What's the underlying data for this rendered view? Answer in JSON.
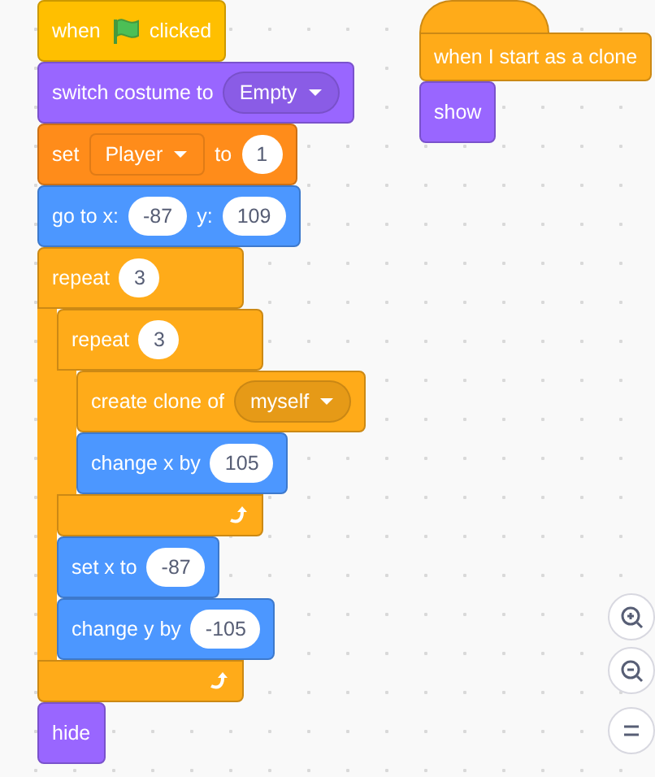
{
  "scripts": [
    {
      "blocks": [
        {
          "kind": "hat",
          "color": "#ffbf00",
          "parts": [
            {
              "kind": "label",
              "text": "when"
            },
            {
              "kind": "flag"
            },
            {
              "kind": "label",
              "text": "clicked"
            }
          ]
        },
        {
          "kind": "stack",
          "color": "#9966ff",
          "parts": [
            {
              "kind": "label",
              "text": "switch costume to"
            },
            {
              "kind": "dropdown",
              "text": "Empty"
            }
          ]
        },
        {
          "kind": "stack",
          "color": "#ff8c1a",
          "parts": [
            {
              "kind": "label",
              "text": "set"
            },
            {
              "kind": "field-dropdown",
              "text": "Player"
            },
            {
              "kind": "label",
              "text": "to"
            },
            {
              "kind": "number",
              "text": "1"
            }
          ]
        },
        {
          "kind": "stack",
          "color": "#4c97ff",
          "parts": [
            {
              "kind": "label",
              "text": "go to x:"
            },
            {
              "kind": "number",
              "text": "-87"
            },
            {
              "kind": "label",
              "text": "y:"
            },
            {
              "kind": "number",
              "text": "109"
            }
          ]
        },
        {
          "kind": "c",
          "color": "#ffab19",
          "parts": [
            {
              "kind": "label",
              "text": "repeat"
            },
            {
              "kind": "number",
              "text": "3"
            }
          ],
          "children": [
            {
              "kind": "c",
              "color": "#ffab19",
              "parts": [
                {
                  "kind": "label",
                  "text": "repeat"
                },
                {
                  "kind": "number",
                  "text": "3"
                }
              ],
              "children": [
                {
                  "kind": "stack",
                  "color": "#ffab19",
                  "parts": [
                    {
                      "kind": "label",
                      "text": "create clone of"
                    },
                    {
                      "kind": "dropdown",
                      "text": "myself"
                    }
                  ]
                },
                {
                  "kind": "stack",
                  "color": "#4c97ff",
                  "parts": [
                    {
                      "kind": "label",
                      "text": "change x by"
                    },
                    {
                      "kind": "number",
                      "text": "105"
                    }
                  ]
                }
              ]
            },
            {
              "kind": "stack",
              "color": "#4c97ff",
              "parts": [
                {
                  "kind": "label",
                  "text": "set x to"
                },
                {
                  "kind": "number",
                  "text": "-87"
                }
              ]
            },
            {
              "kind": "stack",
              "color": "#4c97ff",
              "parts": [
                {
                  "kind": "label",
                  "text": "change y by"
                },
                {
                  "kind": "number",
                  "text": "-105"
                }
              ]
            }
          ]
        },
        {
          "kind": "stack",
          "color": "#9966ff",
          "parts": [
            {
              "kind": "label",
              "text": "hide"
            }
          ]
        }
      ]
    },
    {
      "blocks": [
        {
          "kind": "cap-hat",
          "color": "#ffab19",
          "parts": [
            {
              "kind": "label",
              "text": "when I start as a clone"
            }
          ]
        },
        {
          "kind": "stack",
          "color": "#9966ff",
          "parts": [
            {
              "kind": "label",
              "text": "show"
            }
          ]
        }
      ]
    }
  ],
  "zoom_controls": [
    {
      "kind": "zoom-in"
    },
    {
      "kind": "zoom-out"
    },
    {
      "kind": "reset"
    }
  ]
}
